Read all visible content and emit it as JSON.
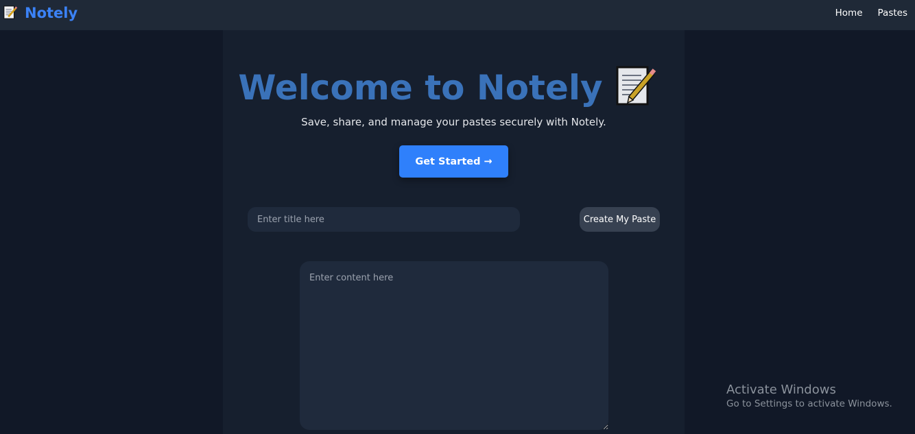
{
  "navbar": {
    "brand_icon": "memo-icon",
    "brand_name": "Notely",
    "links": [
      "Home",
      "Pastes"
    ]
  },
  "hero": {
    "title": "Welcome to Notely",
    "title_icon": "memo-icon",
    "subtitle": "Save, share, and manage your pastes securely with Notely.",
    "cta_label": "Get Started →"
  },
  "form": {
    "title_placeholder": "Enter title here",
    "title_value": "",
    "create_label": "Create My Paste",
    "content_placeholder": "Enter content here",
    "content_value": ""
  },
  "watermark": {
    "title": "Activate Windows",
    "subtitle": "Go to Settings to activate Windows."
  },
  "colors": {
    "brand": "#3b82f6",
    "hero_title": "#3a72b9",
    "cta": "#2f80fb",
    "navbar_bg": "#1f2937",
    "page_bg": "#111827"
  }
}
